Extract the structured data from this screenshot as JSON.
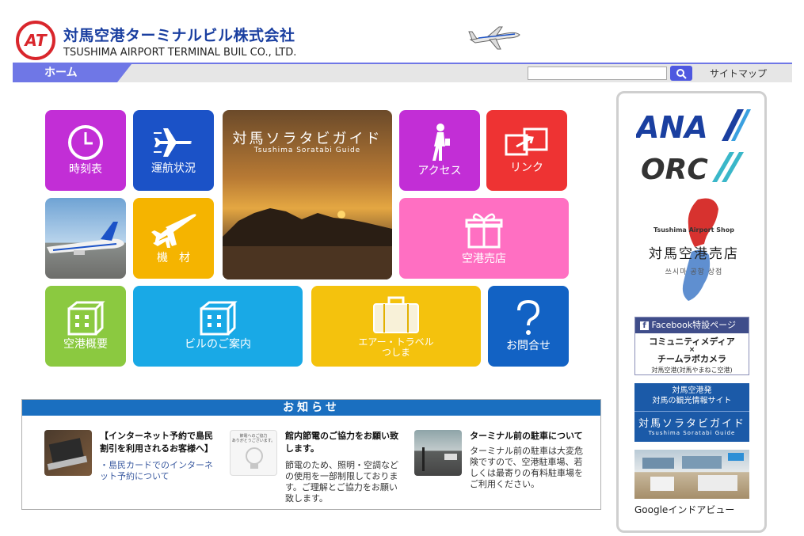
{
  "header": {
    "logo_text": "AT",
    "company_jp": "対馬空港ターミナルビル株式会社",
    "company_en": "TSUSHIMA AIRPORT TERMINAL BUIL CO., LTD."
  },
  "nav": {
    "home": "ホーム",
    "search_placeholder": "",
    "sitemap": "サイトマップ"
  },
  "tiles": {
    "timetable": "時刻表",
    "flight_status": "運航状況",
    "access": "アクセス",
    "link": "リンク",
    "aircraft": "機　材",
    "shop": "空港売店",
    "overview": "空港概要",
    "building": "ビルのご案内",
    "air_travel_1": "エアー・トラベル",
    "air_travel_2": "つしま",
    "contact": "お問合せ",
    "sorabi_title": "対馬ソラタビガイド",
    "sorabi_sub": "Tsushima Soratabi Guide"
  },
  "colors": {
    "timetable": "#c22ed6",
    "flight_status": "#1b52c7",
    "access": "#c22ed6",
    "link": "#ee3333",
    "aircraft": "#f5b400",
    "shop": "#ff6fc2",
    "overview": "#8bc940",
    "building": "#19a9e6",
    "air_travel": "#f4c20d",
    "contact": "#1262c4"
  },
  "news": {
    "heading": "お知らせ",
    "items": [
      {
        "title_1": "【インターネット予約で島民",
        "title_2": "割引を利用されるお客様へ】",
        "link_1": "・島民カードでのインターネ",
        "link_2": "ット予約について"
      },
      {
        "thumb_1": "節電へのご協力",
        "thumb_2": "ありがとうございます。",
        "title_1": "館内節電のご協力をお願い致",
        "title_2": "します。",
        "body": [
          "節電のため、照明・空調など",
          "の使用を一部制限しておりま",
          "す。ご理解とご協力をお願い",
          "致します。"
        ]
      },
      {
        "title_1": "ターミナル前の駐車について",
        "body": [
          "ターミナル前の駐車は大変危",
          "険ですので、空港駐車場、若",
          "しくは最寄りの有料駐車場を",
          "ご利用ください。"
        ]
      }
    ]
  },
  "sidebar": {
    "ana": "ANA",
    "orc": "ORC",
    "shop_en": "Tsushima Airport Shop",
    "shop_jp": "対馬空港売店",
    "shop_kr": "쓰시마 공항 상점",
    "fb_title": "Facebook特設ページ",
    "fb_line1": "コミュニティメディア",
    "fb_line2": "×",
    "fb_line3": "チームラボカメラ",
    "fb_sub": "対馬空港(対馬やまねこ空港)",
    "sora_line1": "対馬空港発",
    "sora_line2": "対馬の観光情報サイト",
    "sora_big": "対馬ソラタビガイド",
    "sora_en": "Tsushima Soratabi Guide",
    "gview": "Googleインドアビュー"
  }
}
